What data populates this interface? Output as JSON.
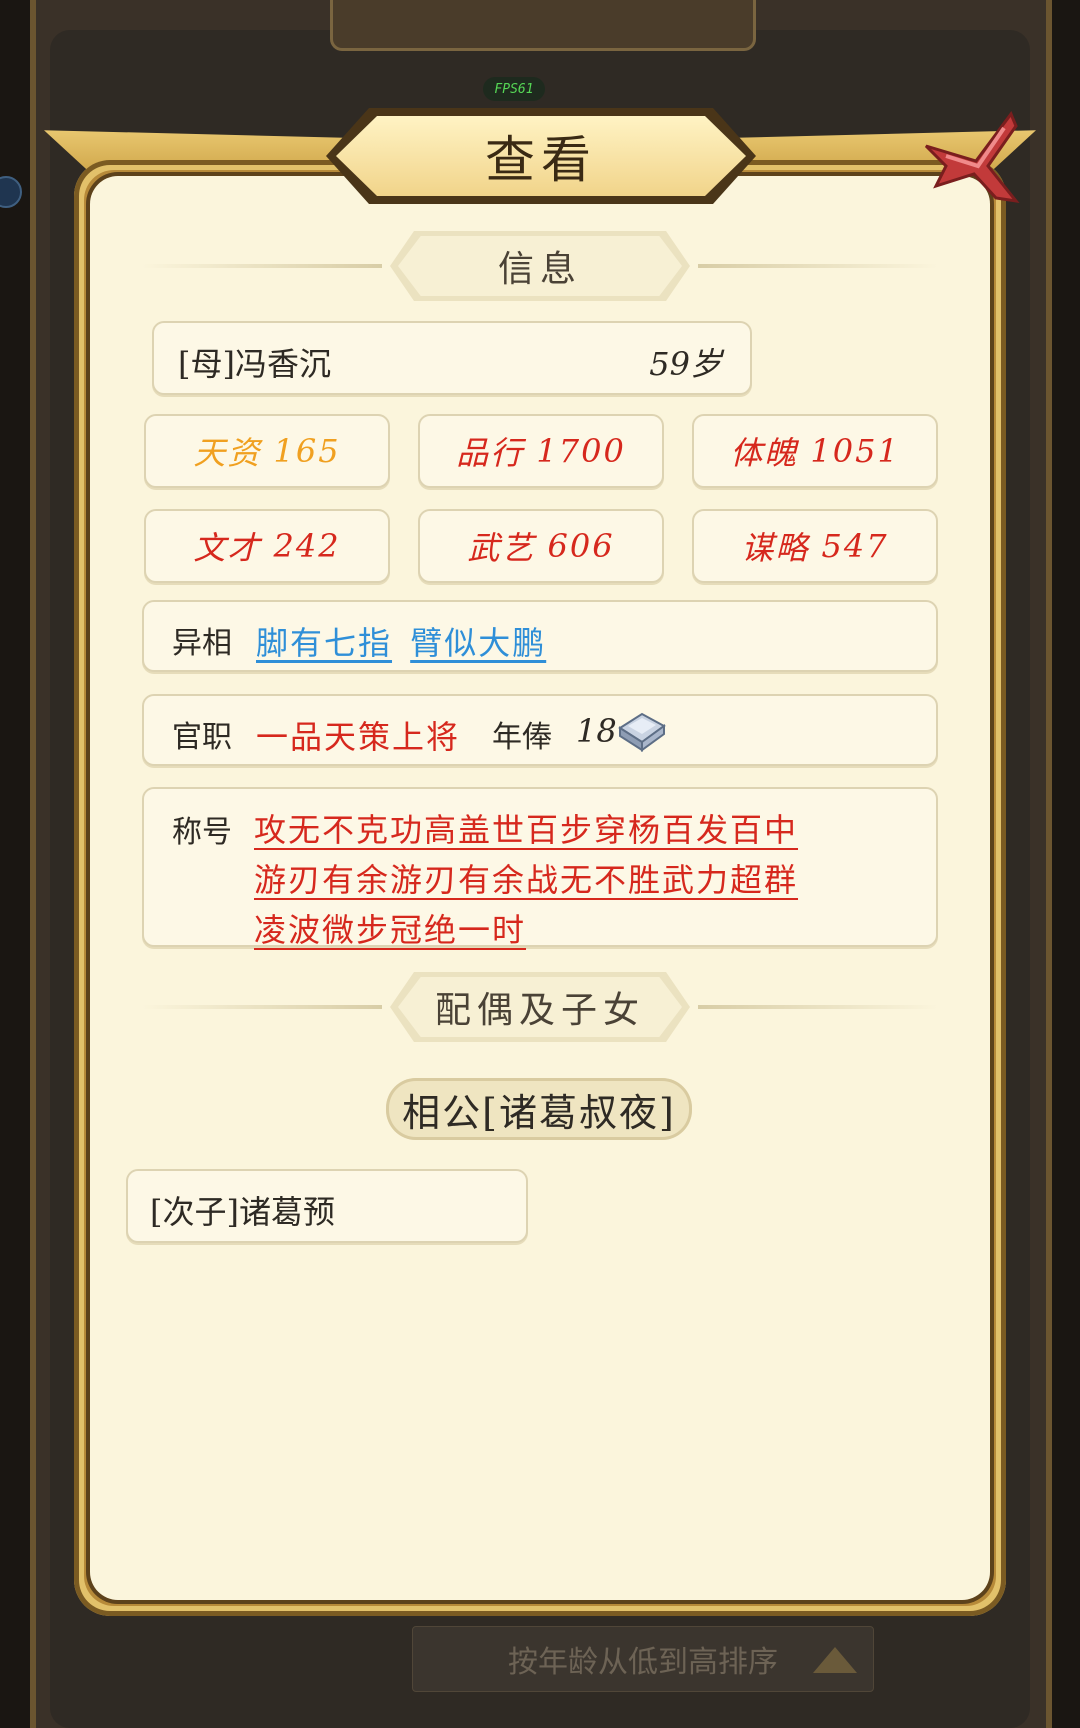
{
  "background": {
    "fps": "FPS61",
    "sort_button": "按年龄从低到高排序"
  },
  "dialog": {
    "title": "查看",
    "section_info": "信息",
    "section_family": "配偶及子女"
  },
  "person": {
    "name": "[母]冯香沉",
    "age": "59岁"
  },
  "stats": [
    {
      "label": "天资",
      "value": "165",
      "color": "#f0a020"
    },
    {
      "label": "品行",
      "value": "1700",
      "color": "#d6281d"
    },
    {
      "label": "体魄",
      "value": "1051",
      "color": "#d6281d"
    },
    {
      "label": "文才",
      "value": "242",
      "color": "#d6281d"
    },
    {
      "label": "武艺",
      "value": "606",
      "color": "#d6281d"
    },
    {
      "label": "谋略",
      "value": "547",
      "color": "#d6281d"
    }
  ],
  "traits": {
    "label": "异相",
    "items": [
      "脚有七指",
      "臂似大鹏"
    ]
  },
  "office": {
    "label": "官职",
    "rank": "一品天策上将",
    "salary_label": "年俸",
    "salary_value": "18",
    "salary_icon": "silver-ingot-icon"
  },
  "honors": {
    "label": "称号",
    "lines": [
      "攻无不克功高盖世百步穿杨百发百中",
      "游刃有余游刃有余战无不胜武力超群",
      "凌波微步冠绝一时"
    ]
  },
  "family": {
    "spouse": "相公[诸葛叔夜]",
    "children": [
      "[次子]诸葛预"
    ]
  }
}
